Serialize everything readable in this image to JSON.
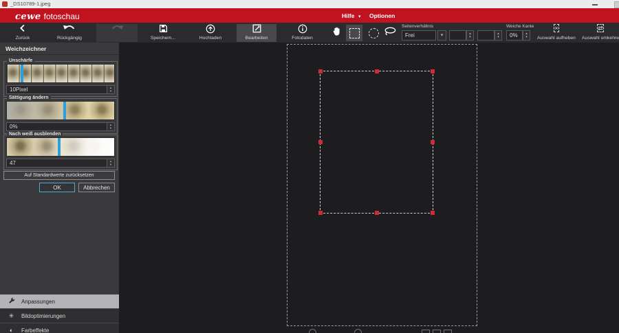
{
  "window": {
    "title": "_DS10789-1.jpeg"
  },
  "menubar": {
    "logo": "cewe",
    "product": "fotoschau",
    "help": "Hilfe",
    "options": "Optionen"
  },
  "toolbar": {
    "back": "Zurück",
    "undo": "Rückgängig",
    "save": "Speichern...",
    "upload": "Hochladen",
    "edit": "Bearbeiten",
    "photodata": "Fotodaten",
    "aspect_label": "Seitenverhältnis",
    "aspect_value": "Frei",
    "soft_edge_label": "Weiche Kante",
    "soft_edge_value": "0%",
    "deselect": "Auswahl aufheben",
    "invert": "Auswahl umkehren"
  },
  "sidebar": {
    "title": "Weichzeichner",
    "blur_label": "Unschärfe",
    "blur_value": "10Pixel",
    "saturation_label": "Sättigung ändern",
    "saturation_value": "0%",
    "fade_label": "Nach weiß ausblenden",
    "fade_value": "47",
    "reset": "Auf Standardwerte zurücksetzen",
    "ok": "OK",
    "cancel": "Abbrechen",
    "accordion": [
      {
        "label": "Anpassungen"
      },
      {
        "label": "Bildoptimierungen"
      },
      {
        "label": "Farbeffekte"
      }
    ]
  },
  "colors": {
    "brand_red": "#c0121f",
    "slider_blue": "#2f9fd9",
    "selection_handle_red": "#cf2b36",
    "ok_border_blue": "#4fa8d6"
  }
}
